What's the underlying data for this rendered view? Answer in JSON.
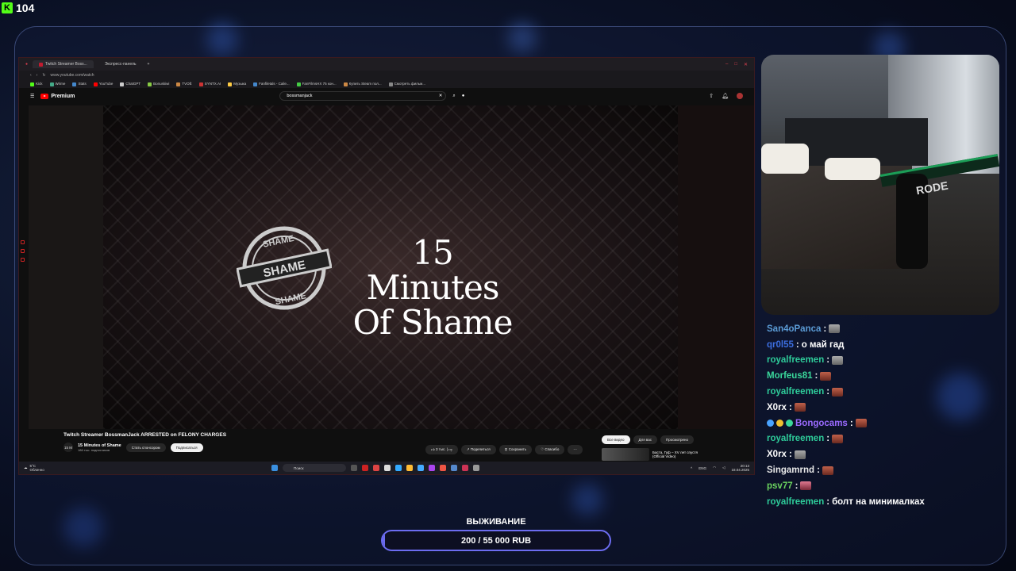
{
  "kick": {
    "viewers": "104"
  },
  "browser": {
    "tabs": [
      "Twitch Streamer Boss...",
      "Экспресс-панель"
    ],
    "url": "www.youtube.com/watch",
    "bookmarks": [
      "Kick",
      "Wrime",
      "Stats",
      "YouTube",
      "ChatGPT",
      "Bonuskiwi",
      "TVOЁ",
      "SYNTX.AI",
      "Музыка",
      "Fanfiletals - Caile...",
      "FanFilmsHX 75 кон...",
      "Купить Steam пол...",
      "Смотреть фильм..."
    ]
  },
  "youtube": {
    "logo": "Premium",
    "search_query": "bossmanjack",
    "video_title_line1": "15 Minutes",
    "video_title_line2": "Of Shame",
    "stamp_text": "SHAME",
    "title": "Twitch Streamer BossmanJack ARRESTED on FELONY CHARGES",
    "channel_avatar": "15 M",
    "channel": "15 Minutes of Shame",
    "subscribers": "186 тыс. подписчиков",
    "sponsor": "Стать спонсором",
    "subscribe": "Подписаться",
    "likes": "3 тыс.",
    "share": "Поделиться",
    "save": "Сохранить",
    "thanks": "Спасибо",
    "rec_tabs": [
      "Все видео",
      "Для вас",
      "Просмотрено"
    ],
    "rec_title": "Баста, Гуф – ХV лет спустя (Official Video)"
  },
  "taskbar": {
    "weather_temp": "5°C",
    "weather_desc": "Облачно",
    "search": "Поиск",
    "lang": "ENG",
    "time": "20:13",
    "date": "18.04.2025"
  },
  "chat": [
    {
      "user": "San4oPanca",
      "color": "#5b9bd5",
      "text": "",
      "emote": "cat"
    },
    {
      "user": "qr0l55",
      "color": "#3c6ee0",
      "text": "о май гад",
      "emote": ""
    },
    {
      "user": "royalfreemen",
      "color": "#2ecc9a",
      "text": "",
      "emote": "cat"
    },
    {
      "user": "Morfeus81",
      "color": "#3ad89b",
      "text": "",
      "emote": "red"
    },
    {
      "user": "royalfreemen",
      "color": "#2ecc9a",
      "text": "",
      "emote": "red"
    },
    {
      "user": "X0rx",
      "color": "#ffffff",
      "text": "",
      "emote": "red"
    },
    {
      "user": "Bongocams",
      "color": "#9b6bff",
      "text": "",
      "emote": "red",
      "badges": true
    },
    {
      "user": "royalfreemen",
      "color": "#2ecc9a",
      "text": "",
      "emote": "red"
    },
    {
      "user": "X0rx",
      "color": "#ffffff",
      "text": "",
      "emote": "cat"
    },
    {
      "user": "Singamrnd",
      "color": "#e8e8e8",
      "text": "",
      "emote": "red"
    },
    {
      "user": "psv77",
      "color": "#6bd35f",
      "text": "",
      "emote": "pink"
    },
    {
      "user": "royalfreemen",
      "color": "#2ecc9a",
      "text": "болт на минималках",
      "emote": ""
    }
  ],
  "goal": {
    "title": "ВЫЖИВАНИЕ",
    "text": "200 / 55 000 RUB",
    "progress": 0.0036,
    "color": "#6c6cf0"
  }
}
